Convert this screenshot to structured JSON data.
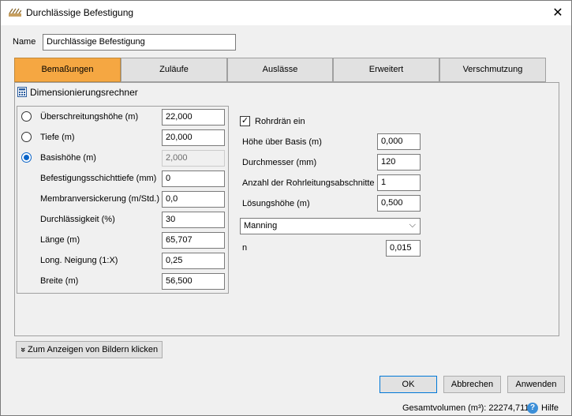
{
  "window": {
    "title": "Durchlässige Befestigung",
    "close_glyph": "✕"
  },
  "name_field": {
    "label": "Name",
    "value": "Durchlässige Befestigung"
  },
  "tabs": [
    {
      "label": "Bemaßungen",
      "active": true
    },
    {
      "label": "Zuläufe",
      "active": false
    },
    {
      "label": "Auslässe",
      "active": false
    },
    {
      "label": "Erweitert",
      "active": false
    },
    {
      "label": "Verschmutzung",
      "active": false
    }
  ],
  "calculator": {
    "label": "Dimensionierungsrechner",
    "icon": "calculator-icon"
  },
  "left_fields": {
    "uberschreitungshohe": {
      "label": "Überschreitungshöhe (m)",
      "value": "22,000",
      "selected": false
    },
    "tiefe": {
      "label": "Tiefe (m)",
      "value": "20,000",
      "selected": false
    },
    "basishohe": {
      "label": "Basishöhe (m)",
      "value": "2,000",
      "selected": true
    },
    "schichttiefe": {
      "label": "Befestigungsschichttiefe (mm)",
      "value": "0"
    },
    "membran": {
      "label": "Membranversickerung (m/Std.)",
      "value": "0,0"
    },
    "durchlassigkeit": {
      "label": "Durchlässigkeit (%)",
      "value": "30"
    },
    "lange": {
      "label": "Länge (m)",
      "value": "65,707"
    },
    "neigung": {
      "label": "Long. Neigung (1:X)",
      "value": "0,25"
    },
    "breite": {
      "label": "Breite (m)",
      "value": "56,500"
    }
  },
  "right_fields": {
    "rohrdran": {
      "label": "Rohrdrän ein",
      "checked": true,
      "check_glyph": "✓"
    },
    "hohe_basis": {
      "label": "Höhe über Basis (m)",
      "value": "0,000"
    },
    "durchmesser": {
      "label": "Durchmesser (mm)",
      "value": "120"
    },
    "abschnitte": {
      "label": "Anzahl der Rohrleitungsabschnitte",
      "value": "1"
    },
    "losungshohe": {
      "label": "Lösungshöhe (m)",
      "value": "0,500"
    },
    "method": {
      "value": "Manning",
      "arrow": "⌵"
    },
    "n": {
      "label": "n",
      "value": "0,015"
    }
  },
  "show_images_button": {
    "label": "Zum Anzeigen von Bildern klicken",
    "glyph": "»"
  },
  "footer": {
    "ok": "OK",
    "cancel": "Abbrechen",
    "apply": "Anwenden",
    "total_volume": "Gesamtvolumen (m³): 22274,711",
    "help": "Hilfe",
    "help_glyph": "?"
  },
  "colors": {
    "active_tab": "#f5a742",
    "radio_selected": "#0a64c8",
    "help_icon": "#3c8fd8"
  }
}
